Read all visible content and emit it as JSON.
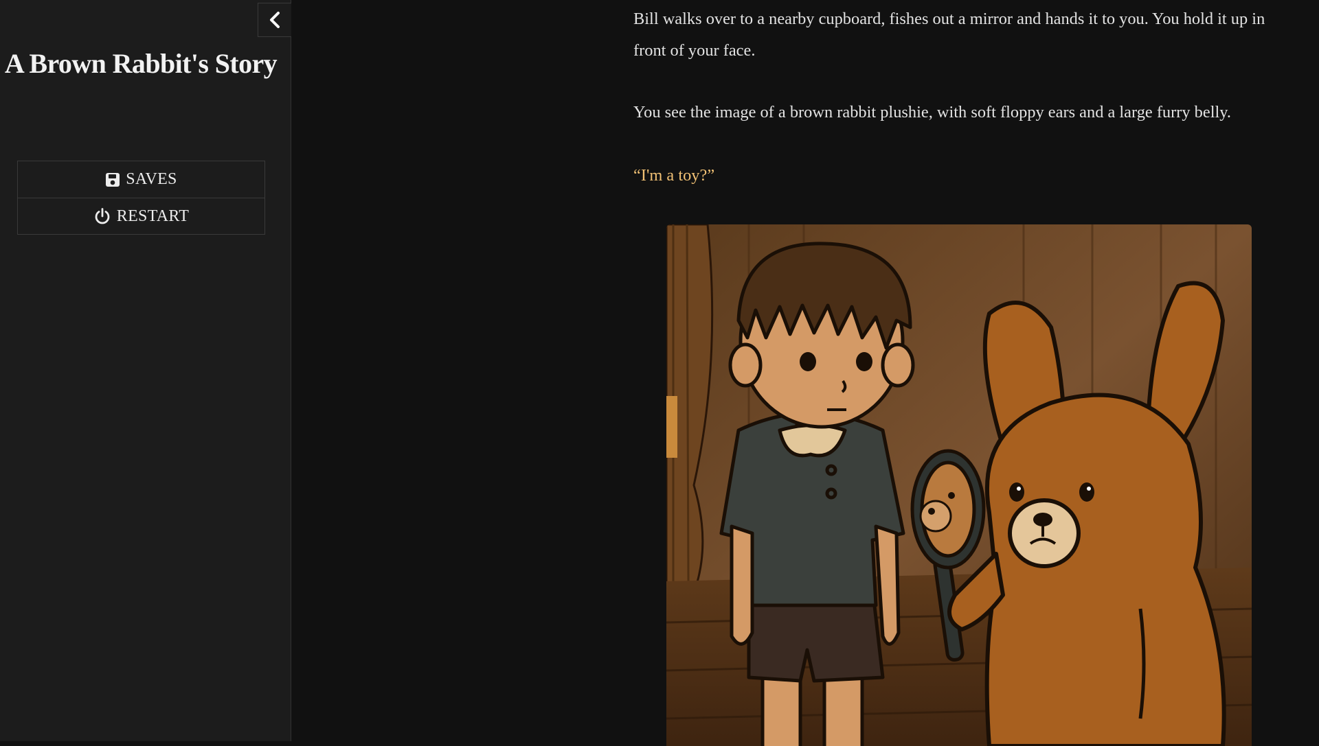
{
  "sidebar": {
    "title": "A Brown Rabbit's Story",
    "menu": [
      {
        "label": "SAVES",
        "icon": "save-icon"
      },
      {
        "label": "RESTART",
        "icon": "power-icon"
      }
    ],
    "collapse_icon": "chevron-left-icon"
  },
  "passage": {
    "paragraphs": [
      "Bill walks over to a nearby cupboard, fishes out a mirror and hands it to you. You hold it up in front of your face.",
      "You see the image of a brown rabbit plushie, with soft floppy ears and a large furry belly.",
      "“I'm a toy?”"
    ],
    "image": "illustration of a boy and a brown rabbit plushie holding a hand mirror"
  },
  "colors": {
    "sidebar_bg": "#1c1c1c",
    "page_bg": "#111111",
    "dialogue": "#f0c074",
    "text": "#e3e3e3"
  }
}
